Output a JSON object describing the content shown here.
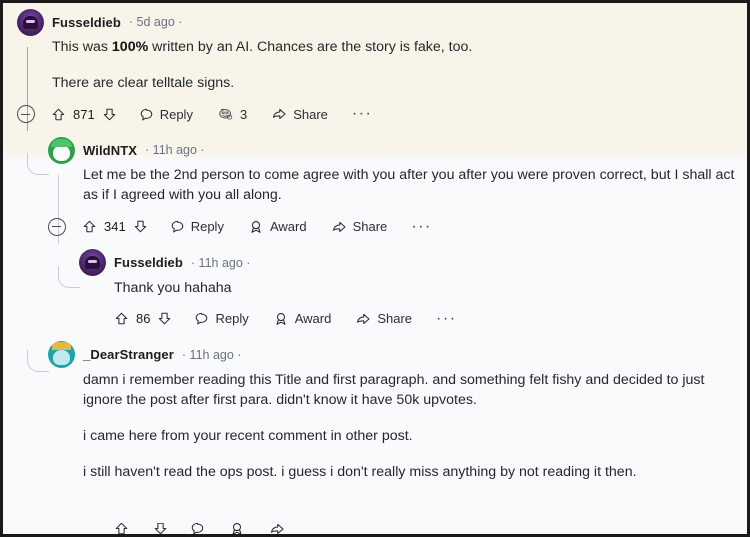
{
  "view": {
    "platform": "reddit-comment-thread",
    "background_color": "#F8FAFC",
    "highlight_color": "#F8F4E9",
    "highlight_rail_color": "#CBA63C",
    "rail_color": "#C9CDD2"
  },
  "labels": {
    "reply": "Reply",
    "share": "Share",
    "award": "Award",
    "more": "···",
    "dot": "·"
  },
  "comments": [
    {
      "id": "c1",
      "depth": 0,
      "highlighted": true,
      "author": "Fusseldieb",
      "avatar": "purple-monster-avatar",
      "timestamp": "5d ago",
      "meta": "· 5d ago ·",
      "paragraphs": [
        {
          "runs": [
            {
              "text": "This was ",
              "bold": false
            },
            {
              "text": "100%",
              "bold": true
            },
            {
              "text": " written by an AI. Chances are the story is fake, too.",
              "bold": false
            }
          ]
        },
        {
          "runs": [
            {
              "text": "There are clear telltale signs.",
              "bold": false
            }
          ]
        }
      ],
      "score": "871",
      "has_collapse": true,
      "awards": {
        "show": true,
        "count": "3",
        "icon": "award-icon"
      },
      "show_award_button": false,
      "show_share": true,
      "show_more": true
    },
    {
      "id": "c2",
      "depth": 1,
      "highlighted": false,
      "author": "WildNTX",
      "avatar": "green-snoo-avatar",
      "timestamp": "11h ago",
      "meta": "· 11h ago ·",
      "paragraphs": [
        {
          "runs": [
            {
              "text": "Let me be the 2nd person to come agree with you after you after you were proven correct, but I shall act as if I agreed with you all along.",
              "bold": false
            }
          ]
        }
      ],
      "score": "341",
      "has_collapse": true,
      "awards": {
        "show": false,
        "count": "",
        "icon": "award-icon"
      },
      "show_award_button": true,
      "show_share": true,
      "show_more": true
    },
    {
      "id": "c3",
      "depth": 2,
      "highlighted": false,
      "author": "Fusseldieb",
      "avatar": "purple-monster-avatar",
      "timestamp": "11h ago",
      "meta": "· 11h ago ·",
      "paragraphs": [
        {
          "runs": [
            {
              "text": "Thank you hahaha",
              "bold": false
            }
          ]
        }
      ],
      "score": "86",
      "has_collapse": false,
      "awards": {
        "show": false,
        "count": "",
        "icon": "award-icon"
      },
      "show_award_button": true,
      "show_share": true,
      "show_more": true
    },
    {
      "id": "c4",
      "depth": 1,
      "highlighted": false,
      "author": "_DearStranger",
      "avatar": "teal-crown-avatar",
      "timestamp": "11h ago",
      "meta": "· 11h ago ·",
      "paragraphs": [
        {
          "runs": [
            {
              "text": "damn i remember reading this Title and first paragraph. and something felt fishy and decided to just ignore the post after first para. didn't know it have 50k upvotes.",
              "bold": false
            }
          ]
        },
        {
          "runs": [
            {
              "text": "i came here from your recent comment in other post.",
              "bold": false
            }
          ]
        },
        {
          "runs": [
            {
              "text": "i still haven't read the ops post. i guess i don't really miss anything by not reading it then.",
              "bold": false
            }
          ]
        }
      ],
      "score": "",
      "has_collapse": false,
      "awards": {
        "show": false,
        "count": "",
        "icon": "award-icon"
      },
      "show_award_button": true,
      "show_share": true,
      "show_more": true,
      "actions_cut_off": true
    }
  ]
}
